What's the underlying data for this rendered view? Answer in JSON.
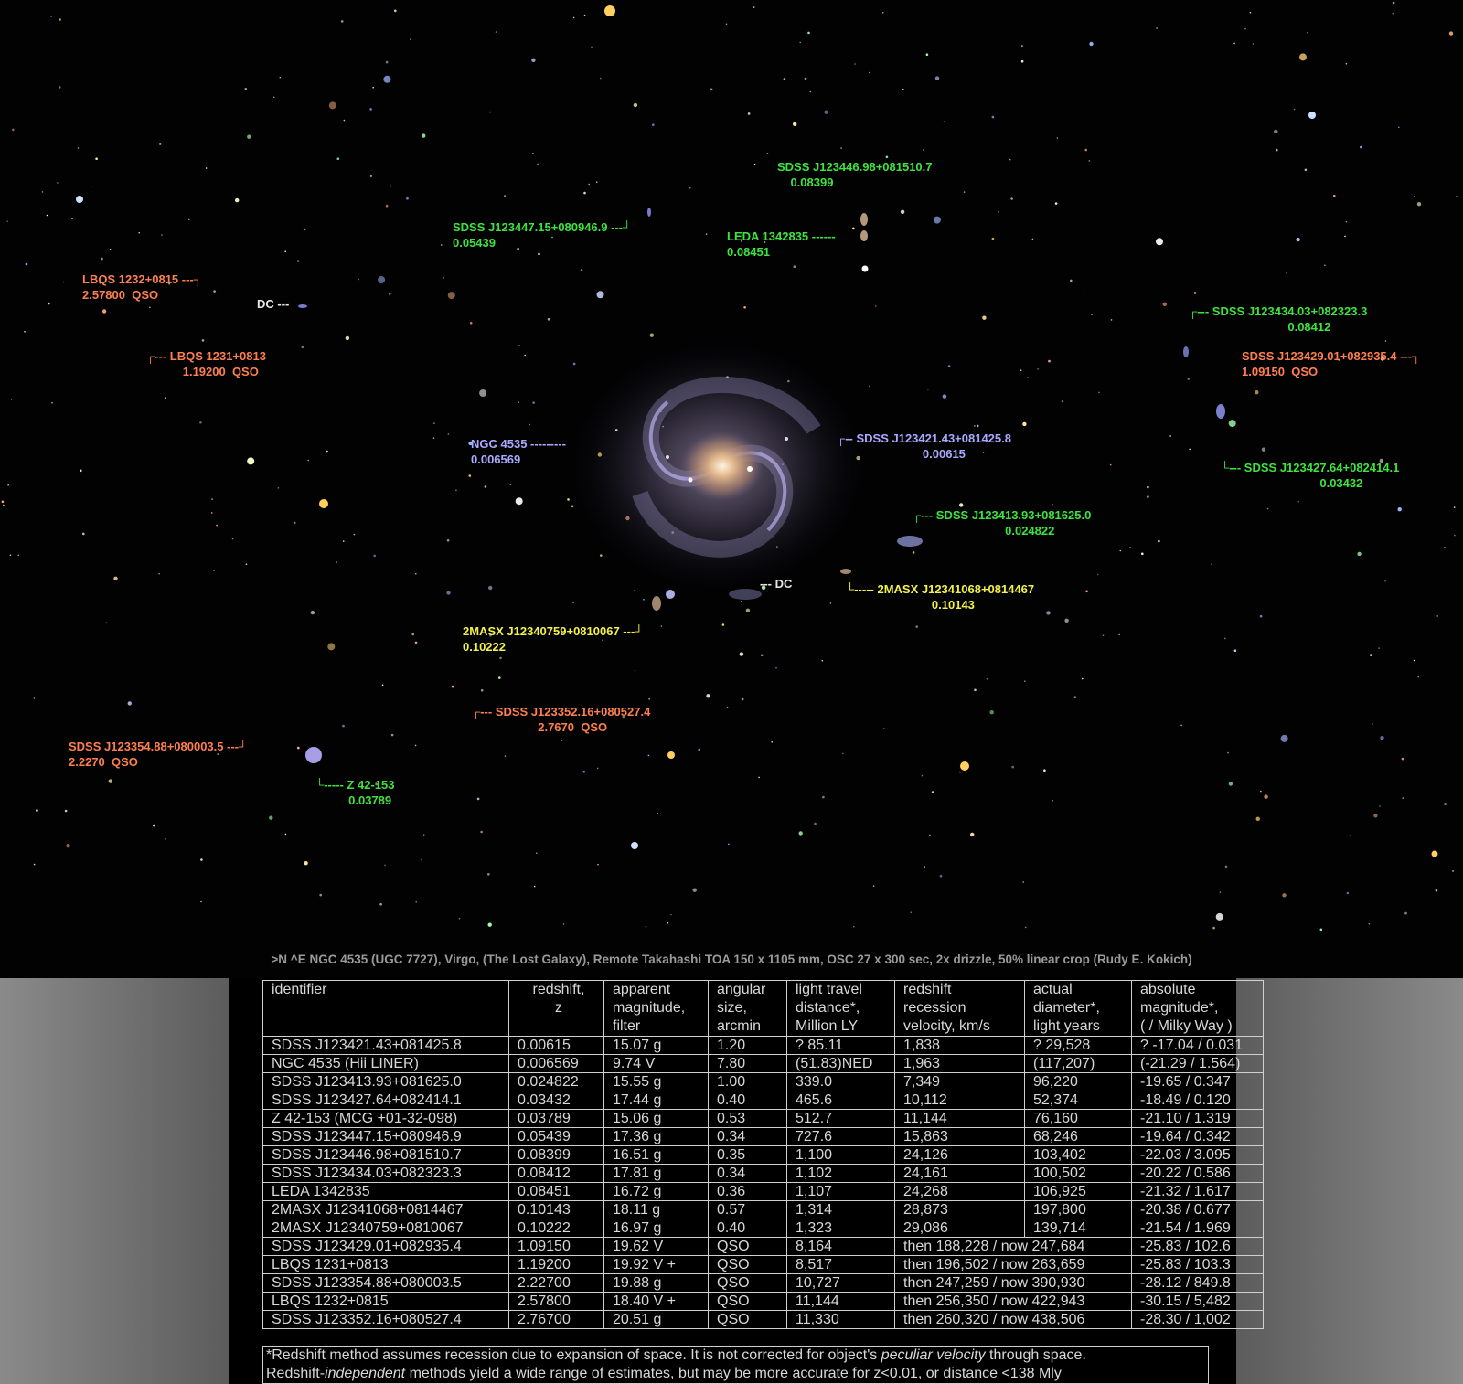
{
  "labels": [
    {
      "id": "sdss-123446",
      "text": "SDSS J123446.98+081510.7\n    0.08399",
      "color": "green"
    },
    {
      "id": "sdss-123447",
      "text": "SDSS J123447.15+080946.9 ---┘\n0.05439",
      "color": "green"
    },
    {
      "id": "leda",
      "text": "LEDA 1342835 ------\n0.08451",
      "color": "green"
    },
    {
      "id": "lbqs-1232",
      "text": "LBQS 1232+0815 ---┐\n2.57800  QSO",
      "color": "orange"
    },
    {
      "id": "dc-top",
      "text": "DC ---",
      "color": "white"
    },
    {
      "id": "lbqs-1231",
      "text": "┌--- LBQS 1231+0813\n           1.19200  QSO",
      "color": "orange"
    },
    {
      "id": "sdss-123434",
      "text": "┌--- SDSS J123434.03+082323.3\n                              0.08412",
      "color": "green"
    },
    {
      "id": "sdss-123429",
      "text": "SDSS J123429.01+082935.4 ---┐\n1.09150  QSO",
      "color": "orange"
    },
    {
      "id": "ngc4535",
      "text": "NGC 4535 ---------\n0.006569",
      "color": "blue"
    },
    {
      "id": "sdss-123421",
      "text": "┌-- SDSS J123421.43+081425.8\n                          0.00615",
      "color": "blue"
    },
    {
      "id": "sdss-123427",
      "text": "└--- SDSS J123427.64+082414.1\n                              0.03432",
      "color": "green"
    },
    {
      "id": "sdss-123413",
      "text": "┌--- SDSS J123413.93+081625.0\n                            0.024822",
      "color": "green"
    },
    {
      "id": "dc-mid",
      "text": "--- DC",
      "color": "white"
    },
    {
      "id": "2masx-1068",
      "text": "└----- 2MASX J12341068+0814467\n                          0.10143",
      "color": "yellow"
    },
    {
      "id": "2masx-0759",
      "text": "2MASX J12340759+0810067 ---┘\n0.10222",
      "color": "yellow"
    },
    {
      "id": "sdss-123352-16",
      "text": "┌--- SDSS J123352.16+080527.4\n                    2.7670  QSO",
      "color": "orange"
    },
    {
      "id": "sdss-123354",
      "text": "SDSS J123354.88+080003.5 ---┘\n2.2270  QSO",
      "color": "orange"
    },
    {
      "id": "z42",
      "text": "└----- Z 42-153\n          0.03789",
      "color": "green"
    }
  ],
  "caption": ">N ^E      NGC 4535 (UGC 7727), Virgo, (The Lost Galaxy), Remote Takahashi TOA 150 x 1105 mm, OSC 27 x 300 sec, 2x drizzle, 50% linear crop     (Rudy E. Kokich)",
  "table": {
    "headers": [
      [
        "identifier"
      ],
      [
        "redshift,",
        "z"
      ],
      [
        "apparent",
        "magnitude,",
        "filter"
      ],
      [
        "angular",
        "size,",
        "arcmin"
      ],
      [
        "light travel",
        "distance*,",
        "Million LY"
      ],
      [
        "redshift",
        "recession",
        "velocity, km/s"
      ],
      [
        "actual",
        "diameter*,",
        "light years"
      ],
      [
        "absolute",
        "magnitude*,",
        "( / Milky Way )"
      ]
    ],
    "rows": [
      [
        "SDSS J123421.43+081425.8",
        "0.00615",
        "15.07 g",
        "1.20",
        "? 85.11",
        "1,838",
        "? 29,528",
        " ? -17.04 / 0.031"
      ],
      [
        "NGC 4535       (Hii LINER)",
        "0.006569",
        "9.74 V",
        "7.80",
        "(51.83)NED",
        "1,963",
        "(117,207)",
        "(-21.29 / 1.564)"
      ],
      [
        "SDSS J123413.93+081625.0",
        "0.024822",
        "15.55 g",
        "1.00",
        "339.0",
        "7,349",
        "96,220",
        "-19.65 / 0.347"
      ],
      [
        "SDSS J123427.64+082414.1",
        "0.03432",
        "17.44 g",
        "0.40",
        "465.6",
        "10,112",
        "52,374",
        "-18.49 / 0.120"
      ],
      [
        "Z 42-153 (MCG +01-32-098)",
        "0.03789",
        "15.06 g",
        "0.53",
        "512.7",
        "11,144",
        "76,160",
        "-21.10 / 1.319"
      ],
      [
        "SDSS J123447.15+080946.9",
        "0.05439",
        "17.36 g",
        "0.34",
        "727.6",
        "15,863",
        "68,246",
        "-19.64 / 0.342"
      ],
      [
        "SDSS J123446.98+081510.7",
        "0.08399",
        "16.51 g",
        "0.35",
        "1,100",
        "24,126",
        "103,402",
        "-22.03 / 3.095"
      ],
      [
        "SDSS J123434.03+082323.3",
        "0.08412",
        "17.81 g",
        "0.34",
        "1,102",
        "24,161",
        "100,502",
        "-20.22 / 0.586"
      ],
      [
        "LEDA 1342835",
        "0.08451",
        "16.72 g",
        "0.36",
        "1,107",
        "24,268",
        "106,925",
        "-21.32 / 1.617"
      ],
      [
        "2MASX J12341068+0814467",
        "0.10143",
        "18.11 g",
        "0.57",
        "1,314",
        "28,873",
        "197,800",
        "-20.38 / 0.677"
      ],
      [
        "2MASX J12340759+0810067",
        "0.10222",
        "16.97 g",
        "0.40",
        "1,323",
        "29,086",
        "139,714",
        " -21.54 / 1.969"
      ],
      [
        "SDSS J123429.01+082935.4",
        "1.09150",
        "19.62 V",
        "QSO",
        "8,164",
        "then 188,228 / now 247,684",
        "",
        "-25.83 / 102.6"
      ],
      [
        "LBQS 1231+0813",
        "1.19200",
        "19.92 V +",
        "QSO",
        "8,517",
        "then 196,502 / now 263,659",
        "",
        "-25.83 / 103.3"
      ],
      [
        "SDSS J123354.88+080003.5",
        "2.22700",
        "19.88 g",
        "QSO",
        "10,727",
        "then 247,259 / now 390,930",
        "",
        "-28.12 / 849.8"
      ],
      [
        "LBQS 1232+0815",
        "2.57800",
        "18.40 V +",
        "QSO",
        "11,144",
        "then 256,350 / now 422,943",
        "",
        "-30.15 / 5,482"
      ],
      [
        "SDSS J123352.16+080527.4",
        "2.76700",
        "20.51 g",
        "QSO",
        "11,330",
        "then 260,320 / now 438,506",
        "",
        "-28.30 / 1,002"
      ]
    ],
    "note_line1a": "*Redshift method assumes recession due to expansion of space. It is not corrected for object's ",
    "note_line1b": "peculiar velocity",
    "note_line1c": " through space.",
    "note_line2a": " Redshift-",
    "note_line2b": "independent",
    "note_line2c": " methods yield a wide range of estimates, but may be more accurate for z<0.01, or distance <138 Mly"
  }
}
